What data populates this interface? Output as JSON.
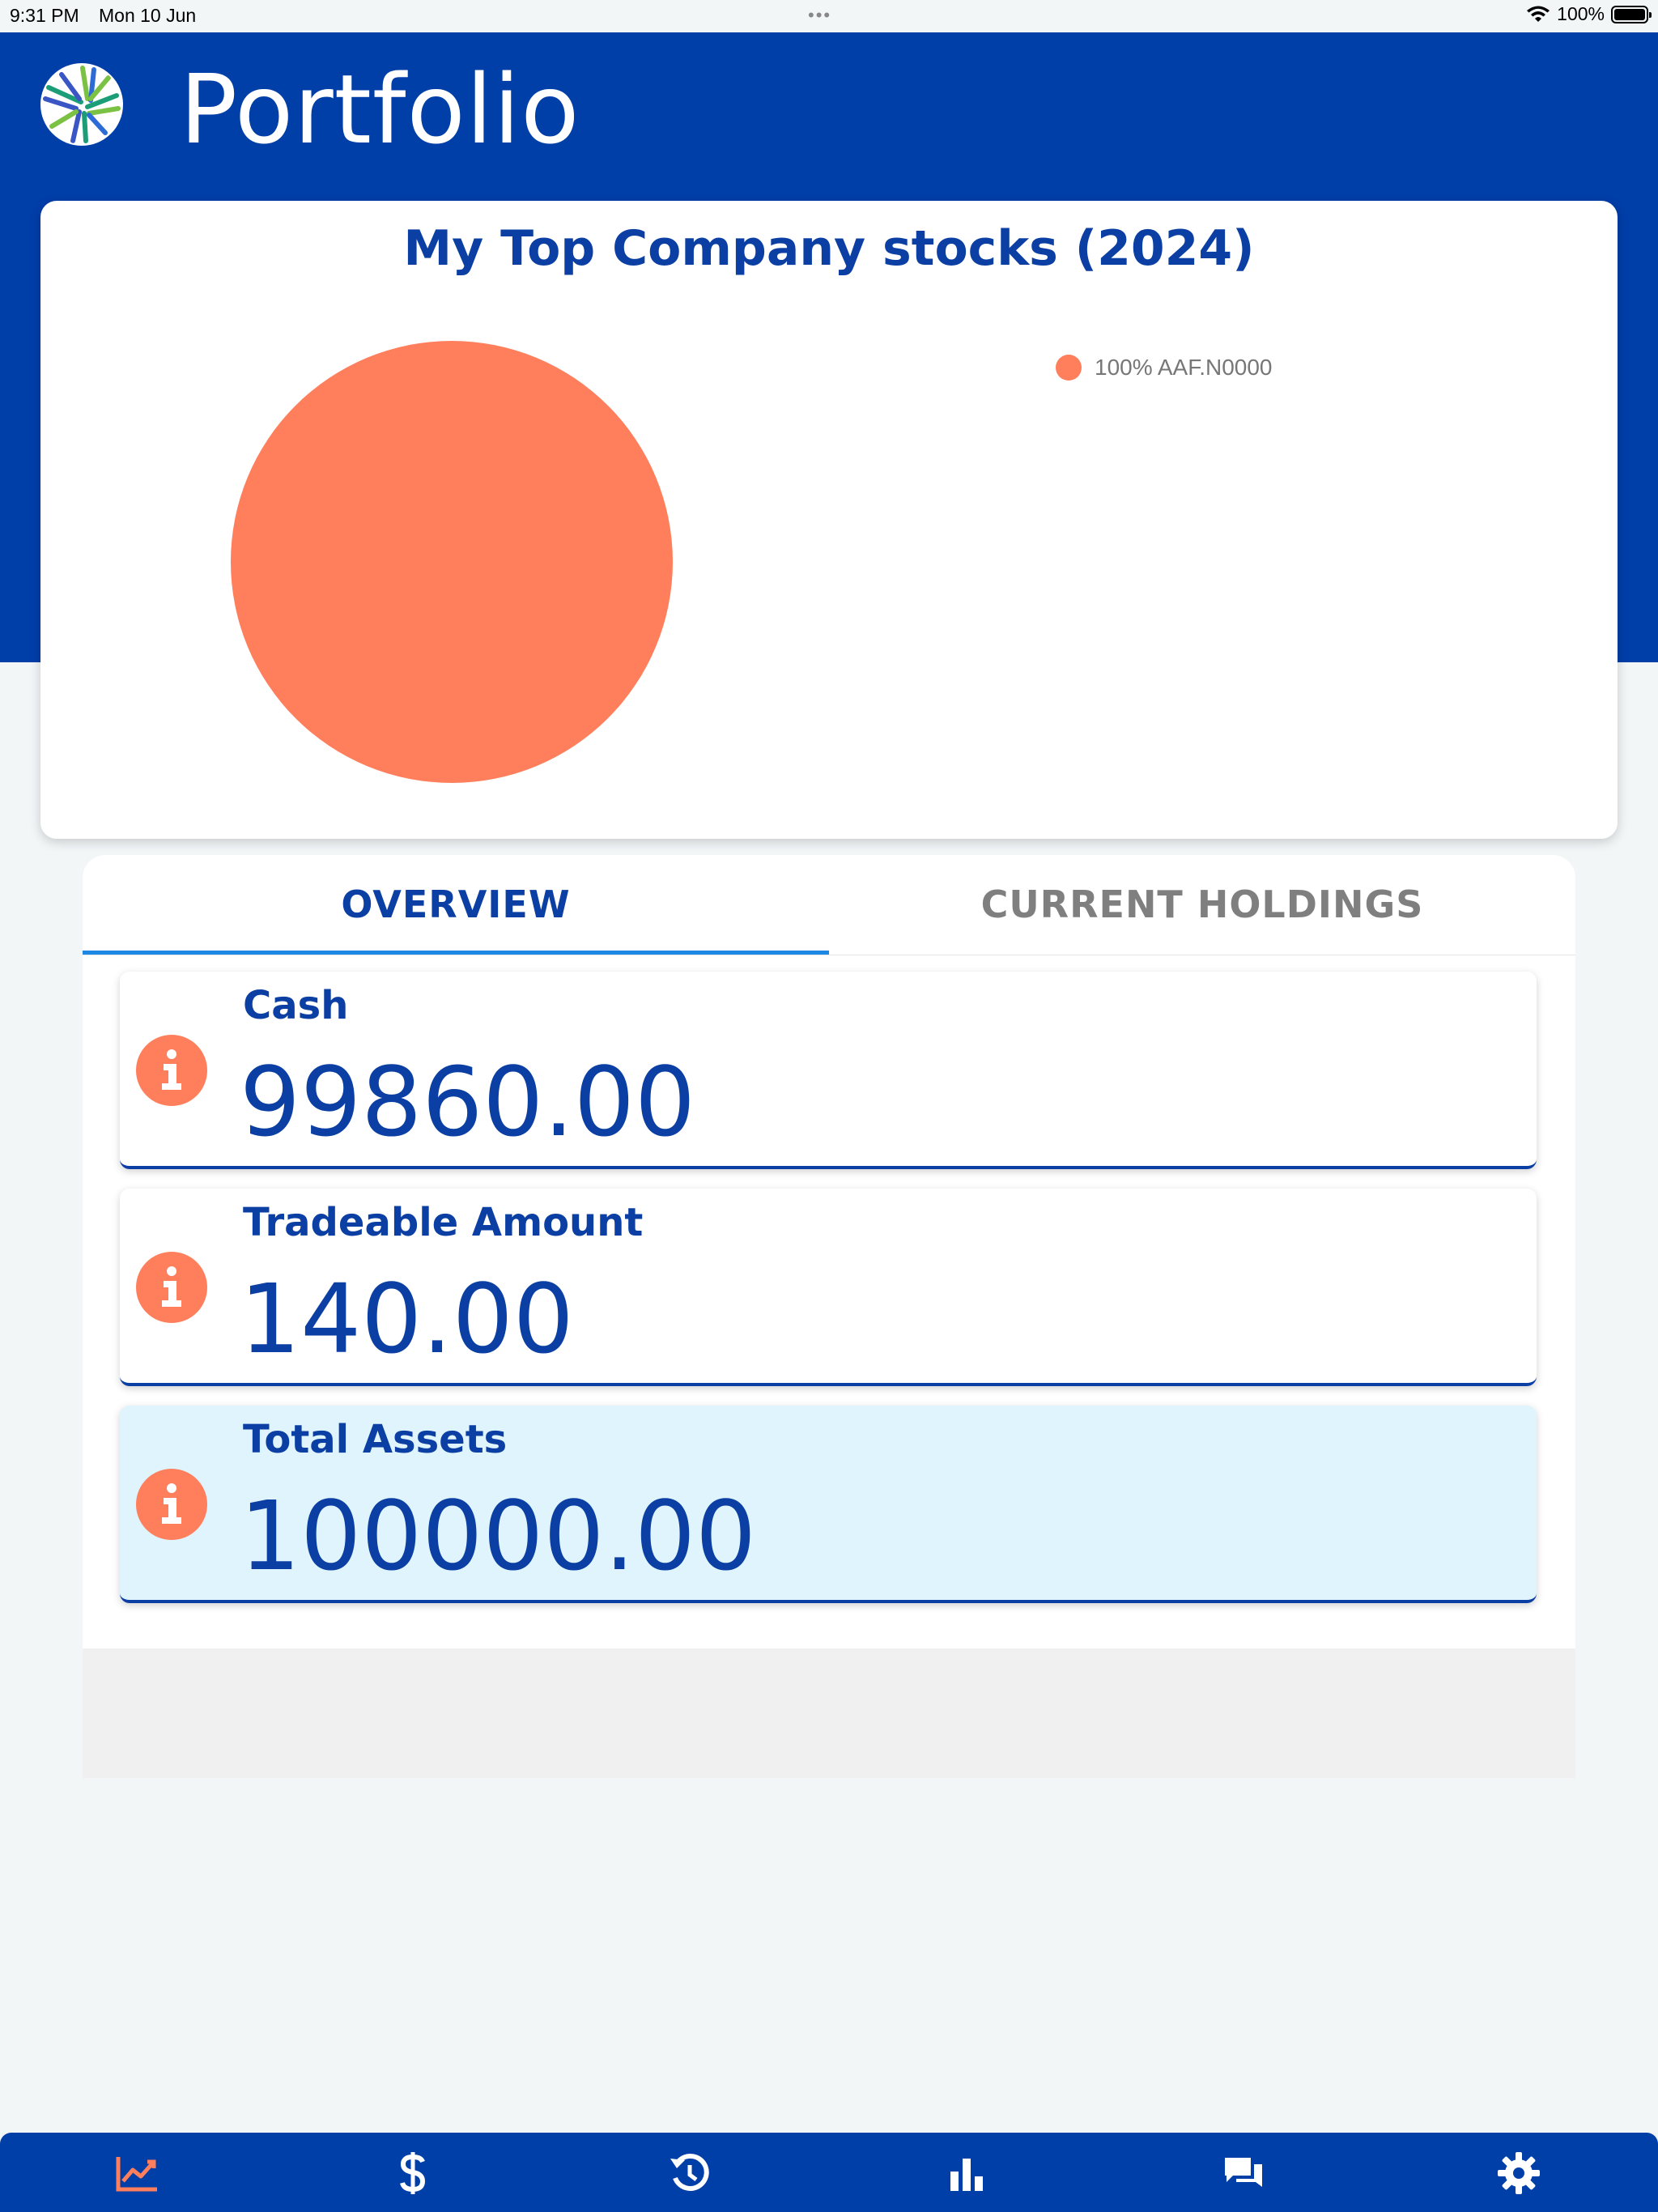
{
  "status_bar": {
    "time": "9:31 PM",
    "date": "Mon 10 Jun",
    "battery": "100%"
  },
  "header": {
    "title": "Portfolio",
    "logo_icon": "striped-globe-logo"
  },
  "colors": {
    "brand_blue": "#003ea8",
    "text_blue": "#0b3fa3",
    "accent_orange": "#ff7f5c",
    "tab_underline": "#1e88e5",
    "highlight_card": "#e0f4fd"
  },
  "chart_data": {
    "type": "pie",
    "title": "My Top Company stocks (2024)",
    "categories": [
      "AAF.N0000"
    ],
    "values": [
      100
    ],
    "legend_entries": [
      "100% AAF.N0000"
    ],
    "colors": [
      "#ff7f5c"
    ],
    "legend_placement": "top-right"
  },
  "tabs": [
    {
      "label": "OVERVIEW",
      "active": true
    },
    {
      "label": "CURRENT HOLDINGS",
      "active": false
    }
  ],
  "metrics": [
    {
      "label": "Cash",
      "value": "99860.00",
      "icon": "info-icon",
      "highlighted": false
    },
    {
      "label": "Tradeable Amount",
      "value": "140.00",
      "icon": "info-icon",
      "highlighted": false
    },
    {
      "label": "Total Assets",
      "value": "100000.00",
      "icon": "info-icon",
      "highlighted": true
    }
  ],
  "bottom_nav": [
    {
      "icon": "trending-chart-icon",
      "active": true
    },
    {
      "icon": "dollar-icon",
      "active": false
    },
    {
      "icon": "history-icon",
      "active": false
    },
    {
      "icon": "bar-chart-icon",
      "active": false
    },
    {
      "icon": "chat-icon",
      "active": false
    },
    {
      "icon": "gear-icon",
      "active": false
    }
  ]
}
